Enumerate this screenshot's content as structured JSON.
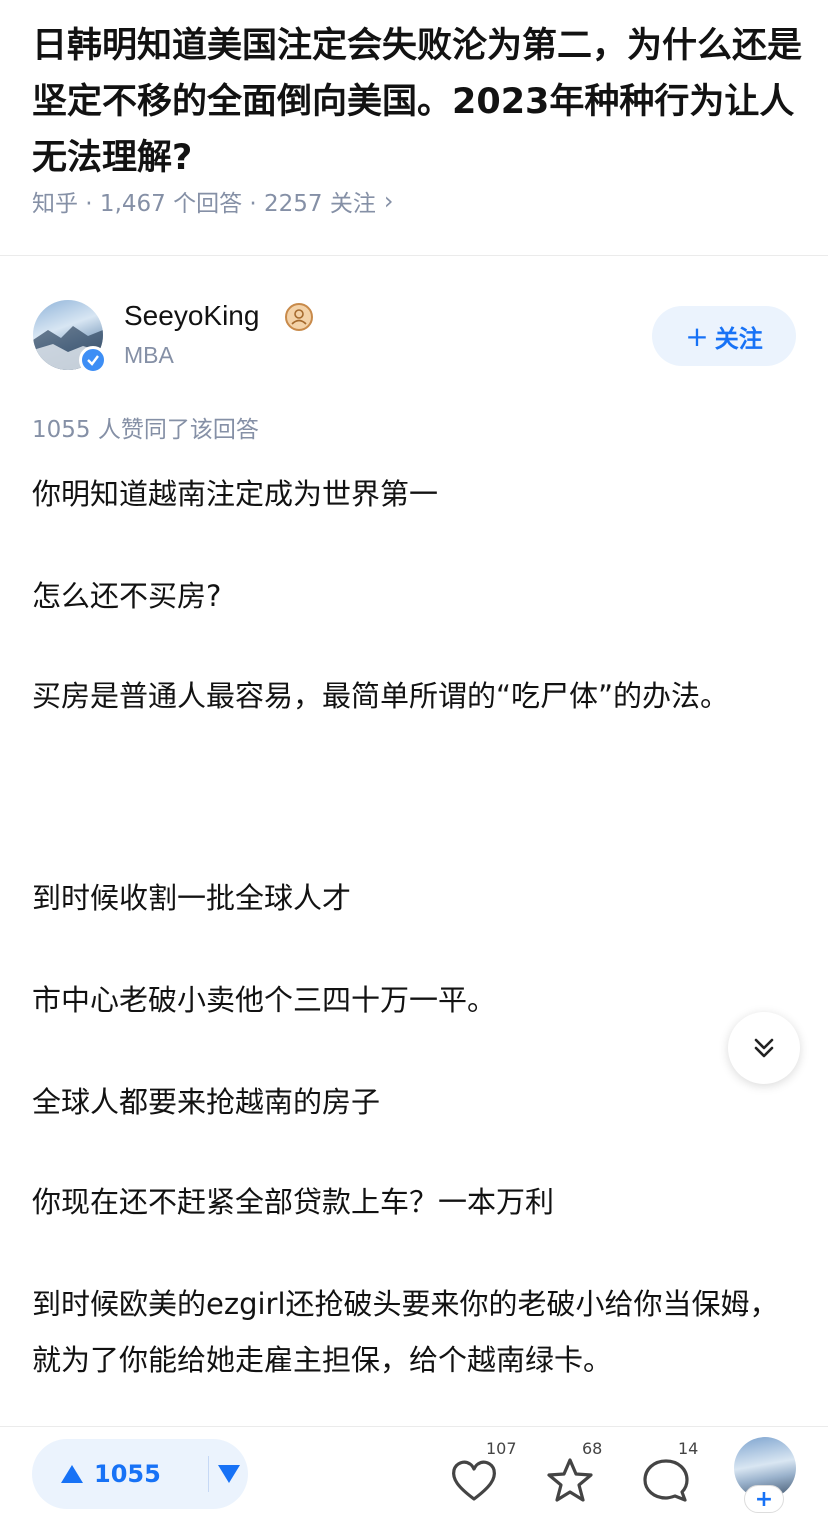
{
  "question": {
    "title": "日韩明知道美国注定会失败沦为第二，为什么还是坚定不移的全面倒向美国。2023年种种行为让人无法理解?",
    "meta": "知乎 · 1,467 个回答 · 2257 关注",
    "chevron": "›"
  },
  "author": {
    "name": "SeeyoKing",
    "headline": "MBA",
    "follow_label": "关注",
    "follow_plus": "+"
  },
  "answer": {
    "vote_summary": "1055 人赞同了该回答",
    "paragraphs": [
      "你明知道越南注定成为世界第一",
      "怎么还不买房?",
      "买房是普通人最容易，最简单所谓的“吃尸体”的办法。",
      "到时候收割一批全球人才",
      "市中心老破小卖他个三四十万一平。",
      "全球人都要来抢越南的房子",
      "你现在还不赶紧全部贷款上车？一本万利",
      "到时候欧美的ezgirl还抢破头要来你的老破小给你当保姆，就为了你能给她走雇主担保，给个越南绿卡。"
    ]
  },
  "bottom_bar": {
    "upvotes": "1055",
    "likes": "107",
    "favorites": "68",
    "comments": "14",
    "plus": "+"
  },
  "colors": {
    "accent": "#1772f6",
    "accent_bg": "#ebf3fd",
    "muted": "#8590a6",
    "text": "#121212"
  },
  "icons": [
    "chevron-right-icon",
    "verified-badge-icon",
    "medal-icon",
    "scroll-down-icon",
    "upvote-icon",
    "downvote-icon",
    "heart-icon",
    "star-icon",
    "comment-icon"
  ]
}
